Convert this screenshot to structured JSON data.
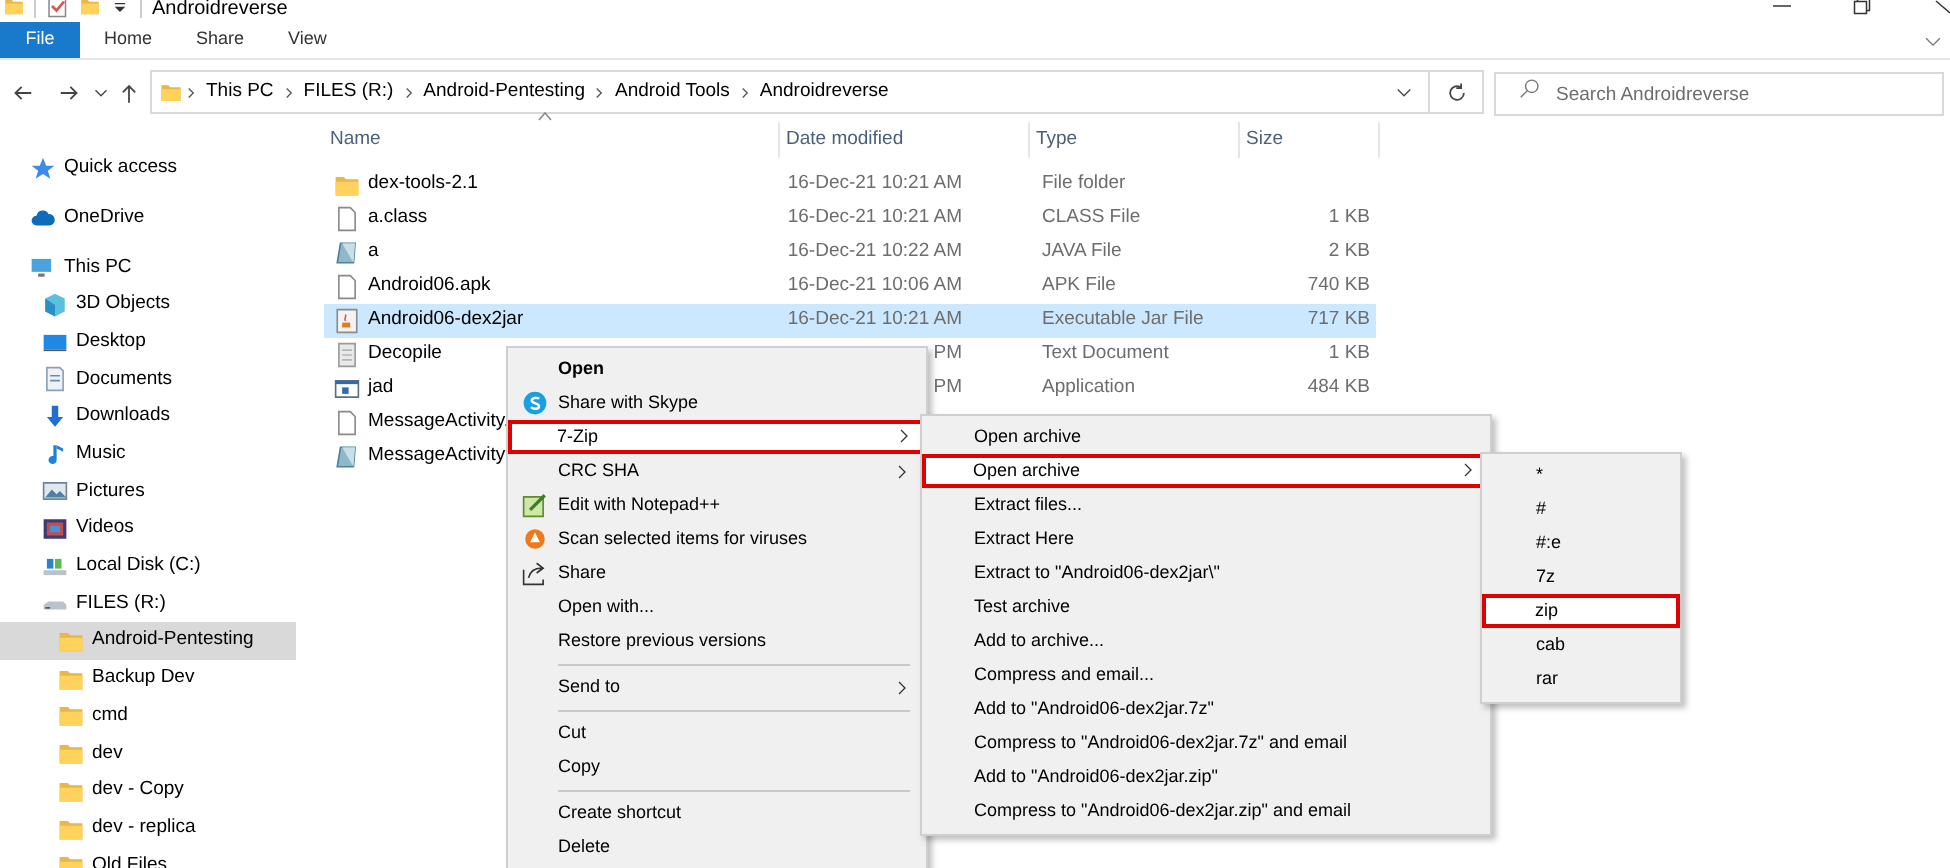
{
  "window": {
    "title": "Androidreverse"
  },
  "ribbon": {
    "tabs": [
      {
        "label": "File",
        "kind": "file-menu"
      },
      {
        "label": "Home",
        "kind": "tab"
      },
      {
        "label": "Share",
        "kind": "tab"
      },
      {
        "label": "View",
        "kind": "tab"
      }
    ]
  },
  "address": {
    "segments": [
      "This PC",
      "FILES (R:)",
      "Android-Pentesting",
      "Android Tools",
      "Androidreverse"
    ]
  },
  "search": {
    "placeholder": "Search Androidreverse"
  },
  "sidebar": {
    "items": [
      {
        "label": "Quick access",
        "kind": "star",
        "selected": false
      },
      {
        "label": "OneDrive",
        "kind": "cloud",
        "selected": false
      },
      {
        "label": "This PC",
        "kind": "pc",
        "selected": false,
        "children": [
          {
            "label": "3D Objects",
            "kind": "cube",
            "selected": false
          },
          {
            "label": "Desktop",
            "kind": "desktop",
            "selected": false
          },
          {
            "label": "Documents",
            "kind": "documents",
            "selected": false
          },
          {
            "label": "Downloads",
            "kind": "downloads",
            "selected": false
          },
          {
            "label": "Music",
            "kind": "music",
            "selected": false
          },
          {
            "label": "Pictures",
            "kind": "pictures",
            "selected": false
          },
          {
            "label": "Videos",
            "kind": "videos",
            "selected": false
          },
          {
            "label": "Local Disk (C:)",
            "kind": "disk",
            "selected": false
          },
          {
            "label": "FILES (R:)",
            "kind": "drive",
            "selected": false,
            "children": [
              {
                "label": "Android-Pentesting",
                "kind": "folder",
                "selected": true
              },
              {
                "label": "Backup Dev",
                "kind": "folder",
                "selected": false
              },
              {
                "label": "cmd",
                "kind": "folder",
                "selected": false
              },
              {
                "label": "dev",
                "kind": "folder",
                "selected": false
              },
              {
                "label": "dev - Copy",
                "kind": "folder",
                "selected": false
              },
              {
                "label": "dev - replica",
                "kind": "folder",
                "selected": false
              },
              {
                "label": "Old Files",
                "kind": "folder",
                "selected": false
              }
            ]
          }
        ]
      }
    ]
  },
  "table": {
    "columns": [
      {
        "label": "Name",
        "sorted": true
      },
      {
        "label": "Date modified",
        "sorted": false
      },
      {
        "label": "Type",
        "sorted": false
      },
      {
        "label": "Size",
        "sorted": false
      }
    ],
    "rows": [
      {
        "kind": "folder",
        "name": "dex-tools-2.1",
        "date": "16-Dec-21 10:21 AM",
        "type": "File folder",
        "selected": false
      },
      {
        "kind": "blank",
        "name": "a.class",
        "date": "16-Dec-21 10:21 AM",
        "type": "CLASS File",
        "size": "1 KB",
        "selected": false
      },
      {
        "kind": "script",
        "name": "a",
        "date": "16-Dec-21 10:22 AM",
        "type": "JAVA File",
        "size": "2 KB",
        "selected": false
      },
      {
        "kind": "blank",
        "name": "Android06.apk",
        "date": "16-Dec-21 10:06 AM",
        "type": "APK File",
        "size": "740 KB",
        "selected": false
      },
      {
        "kind": "jar",
        "name": "Android06-dex2jar",
        "date": "16-Dec-21 10:21 AM",
        "type": "Executable Jar File",
        "size": "717 KB",
        "selected": true
      },
      {
        "kind": "text",
        "name": "Decopile",
        "date": "PM",
        "type": "Text Document",
        "size": "1 KB",
        "selected": false
      },
      {
        "kind": "app",
        "name": "jad",
        "date": "PM",
        "type": "Application",
        "size": "484 KB",
        "selected": false
      },
      {
        "kind": "blank",
        "name": "MessageActivity.",
        "selected": false
      },
      {
        "kind": "script",
        "name": "MessageActivity",
        "selected": false
      }
    ]
  },
  "context_menu": {
    "items": [
      {
        "kind": "default",
        "label": "Open",
        "selected": false
      },
      {
        "kind": "skype",
        "label": "Share with Skype",
        "selected": false
      },
      {
        "kind": "submenu",
        "label": "7-Zip",
        "selected": true
      },
      {
        "kind": "submenu",
        "label": "CRC SHA",
        "selected": false
      },
      {
        "kind": "notepad",
        "label": "Edit with Notepad++",
        "selected": false
      },
      {
        "kind": "antivirus",
        "label": "Scan selected items for viruses",
        "selected": false
      },
      {
        "kind": "share",
        "label": "Share",
        "selected": false
      },
      {
        "kind": "command",
        "label": "Open with...",
        "selected": false
      },
      {
        "kind": "command",
        "label": "Restore previous versions",
        "selected": false
      },
      {
        "kind": "separator"
      },
      {
        "kind": "submenu",
        "label": "Send to",
        "selected": false
      },
      {
        "kind": "separator"
      },
      {
        "kind": "command",
        "label": "Cut",
        "selected": false
      },
      {
        "kind": "command",
        "label": "Copy",
        "selected": false
      },
      {
        "kind": "separator"
      },
      {
        "kind": "command",
        "label": "Create shortcut",
        "selected": false
      },
      {
        "kind": "command",
        "label": "Delete",
        "selected": false
      }
    ]
  },
  "zip_menu": {
    "items": [
      {
        "kind": "command",
        "label": "Open archive",
        "selected": false
      },
      {
        "kind": "submenu",
        "label": "Open archive",
        "selected": true
      },
      {
        "kind": "command",
        "label": "Extract files...",
        "selected": false
      },
      {
        "kind": "command",
        "label": "Extract Here",
        "selected": false
      },
      {
        "kind": "command",
        "label": "Extract to \"Android06-dex2jar\\\"",
        "selected": false
      },
      {
        "kind": "command",
        "label": "Test archive",
        "selected": false
      },
      {
        "kind": "command",
        "label": "Add to archive...",
        "selected": false
      },
      {
        "kind": "command",
        "label": "Compress and email...",
        "selected": false
      },
      {
        "kind": "command",
        "label": "Add to \"Android06-dex2jar.7z\"",
        "selected": false
      },
      {
        "kind": "command",
        "label": "Compress to \"Android06-dex2jar.7z\" and email",
        "selected": false
      },
      {
        "kind": "command",
        "label": "Add to \"Android06-dex2jar.zip\"",
        "selected": false
      },
      {
        "kind": "command",
        "label": "Compress to \"Android06-dex2jar.zip\" and email",
        "selected": false
      }
    ]
  },
  "format_menu": {
    "items": [
      {
        "label": "*",
        "selected": false
      },
      {
        "label": "#",
        "selected": false
      },
      {
        "label": "#:e",
        "selected": false
      },
      {
        "label": "7z",
        "selected": false
      },
      {
        "label": "zip",
        "selected": true
      },
      {
        "label": "cab",
        "selected": false
      },
      {
        "label": "rar",
        "selected": false
      }
    ]
  }
}
